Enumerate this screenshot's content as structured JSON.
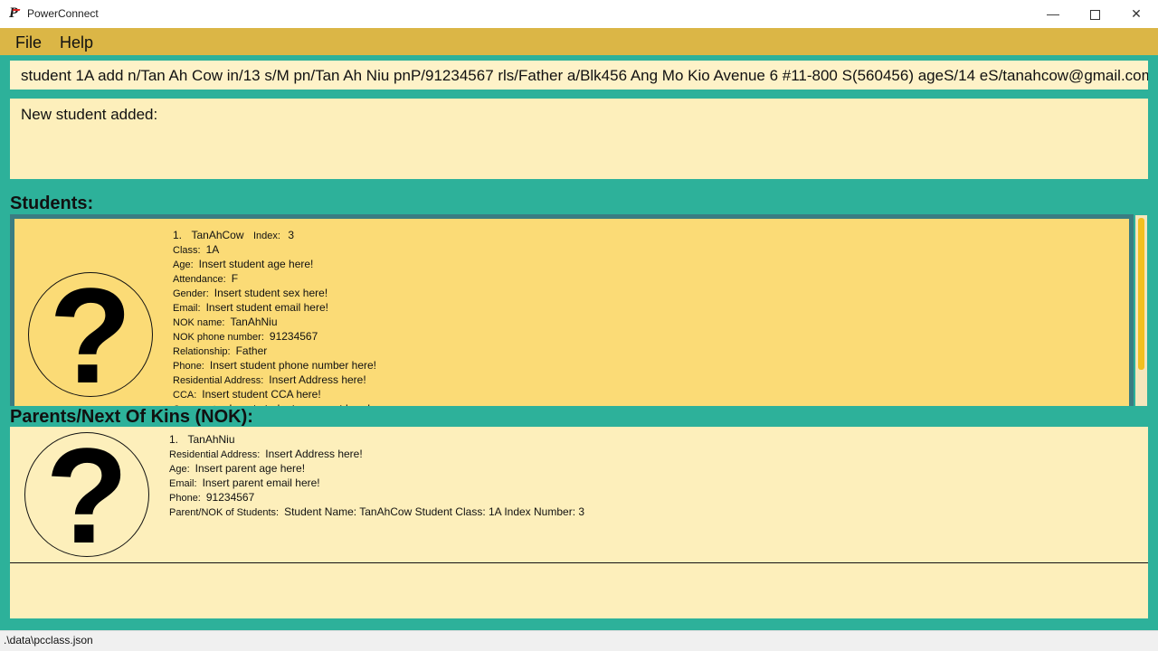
{
  "window": {
    "title": "PowerConnect",
    "minimize": "—",
    "maximize": "",
    "close": "✕"
  },
  "menu": {
    "file": "File",
    "help": "Help"
  },
  "command": {
    "value": "student 1A add n/Tan Ah Cow in/13 s/M pn/Tan Ah Niu pnP/91234567 rls/Father a/Blk456 Ang Mo Kio Avenue 6 #11-800 S(560456) ageS/14 eS/tanahcow@gmail.com"
  },
  "result": {
    "text": "New student added:"
  },
  "sections": {
    "students": "Students:",
    "nok": "Parents/Next Of Kins (NOK):"
  },
  "student": {
    "number": "1.",
    "name": "TanAhCow",
    "index_label": "Index:",
    "index": "3",
    "fields": [
      {
        "label": "Class:",
        "value": "1A"
      },
      {
        "label": "Age:",
        "value": "Insert student age here!"
      },
      {
        "label": "Attendance:",
        "value": "F"
      },
      {
        "label": "Gender:",
        "value": "Insert student sex here!"
      },
      {
        "label": "Email:",
        "value": "Insert student email here!"
      },
      {
        "label": "NOK name:",
        "value": "TanAhNiu"
      },
      {
        "label": "NOK phone number:",
        "value": "91234567"
      },
      {
        "label": "Relationship:",
        "value": "Father"
      },
      {
        "label": "Phone:",
        "value": "Insert student phone number here!"
      },
      {
        "label": "Residential Address:",
        "value": "Insert Address here!"
      },
      {
        "label": "CCA:",
        "value": "Insert student CCA here!"
      },
      {
        "label": "Comments:",
        "value": "Insert student comment here!"
      }
    ]
  },
  "nok": {
    "number": "1.",
    "name": "TanAhNiu",
    "fields": [
      {
        "label": "Residential Address:",
        "value": "Insert Address here!"
      },
      {
        "label": "Age:",
        "value": "Insert parent age here!"
      },
      {
        "label": "Email:",
        "value": "Insert parent email here!"
      },
      {
        "label": "Phone:",
        "value": "91234567"
      },
      {
        "label": "Parent/NOK of Students:",
        "value": "Student Name: TanAhCow Student Class: 1A Index Number: 3"
      }
    ]
  },
  "avatar_glyph": "?",
  "status": {
    "path": ".\\data\\pcclass.json"
  }
}
